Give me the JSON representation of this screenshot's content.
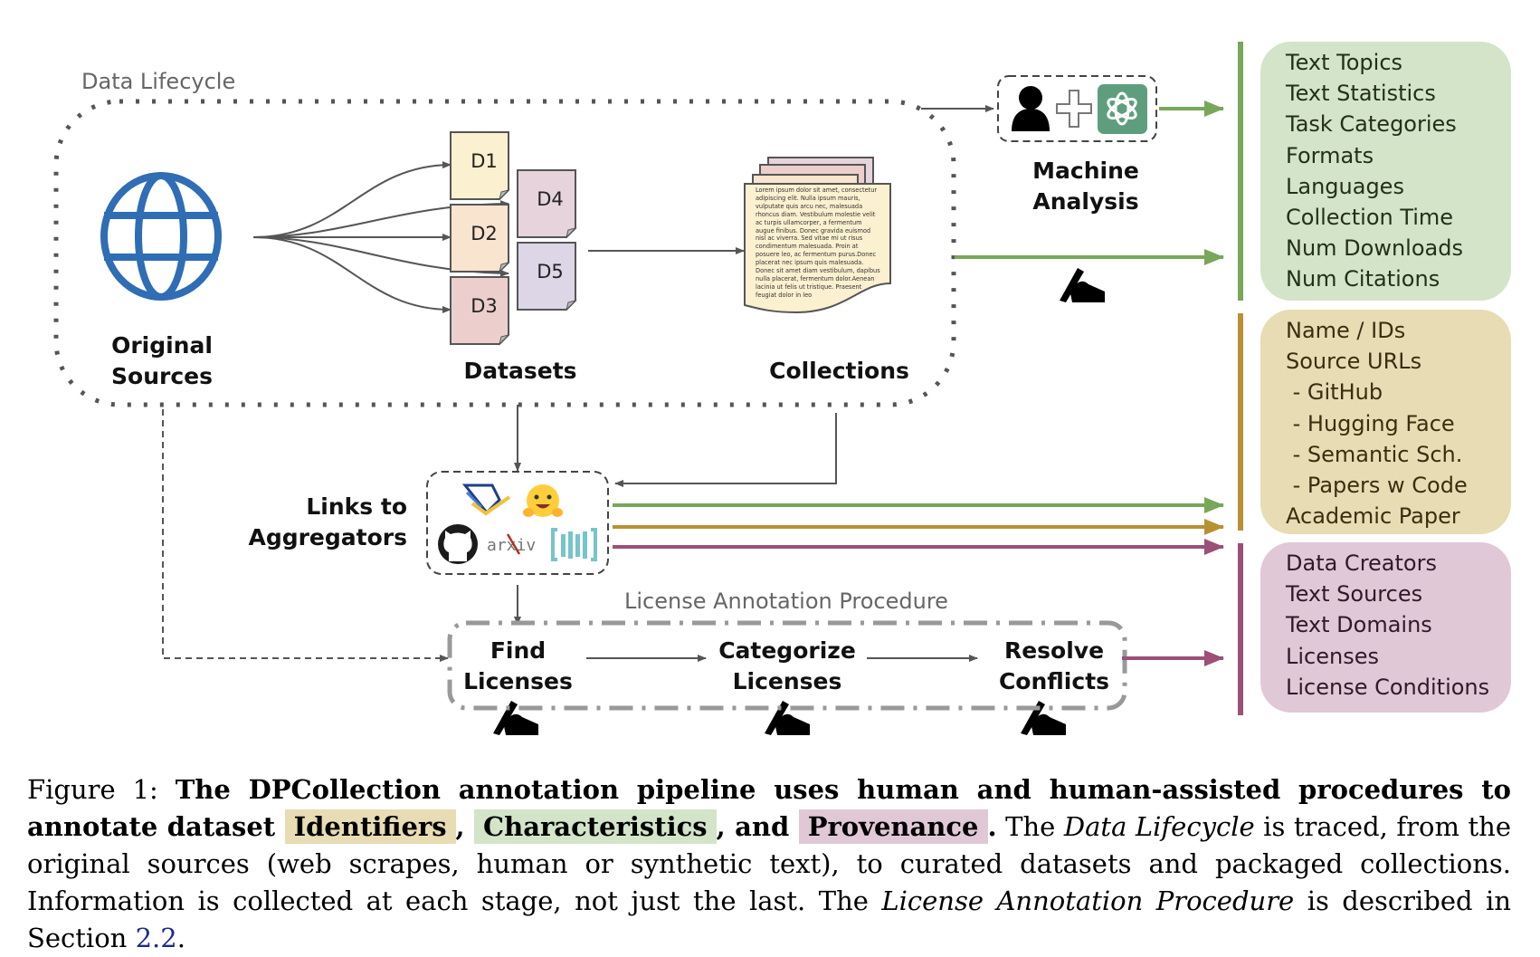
{
  "figure": {
    "data_lifecycle_label": "Data Lifecycle",
    "original_sources": {
      "line1": "Original",
      "line2": "Sources",
      "icon": "globe-icon"
    },
    "datasets": {
      "label": "Datasets",
      "items": [
        {
          "id": "D1",
          "color": "#fbf0cf"
        },
        {
          "id": "D2",
          "color": "#f8e4cf"
        },
        {
          "id": "D3",
          "color": "#eccfcc"
        },
        {
          "id": "D4",
          "color": "#e6d3dc"
        },
        {
          "id": "D5",
          "color": "#dcd6e6"
        }
      ]
    },
    "collections": {
      "label": "Collections",
      "lorem": "Lorem ipsum dolor sit amet, consectetur adipiscing elit. Nulla ipsum mauris, vulputate quis arcu nec, malesuada rhoncus diam. Vestibulum molestie velit ac turpis ullamcorper, a fermentum augue finibus. Donec gravida euismod nisl ac viverra. Sed vitae mi ut risus condimentum malesuada. Proin at posuere leo, ac fermentum purus.Donec placerat nec ipsum quis malesuada. Donec sit amet diam vestibulum, dapibus nulla placerat, fermentum dolor.Aenean lacinia ut felis ut tristique. Praesent feugiat dolor in leo",
      "page_colors": [
        "#e6d3dc",
        "#eccfcc",
        "#f8e4cf",
        "#fbf0cf"
      ]
    },
    "machine_analysis": {
      "line1": "Machine",
      "line2": "Analysis",
      "icons": [
        "person-icon",
        "plus-icon",
        "openai-logo-icon"
      ]
    },
    "aggregators": {
      "line1": "Links to",
      "line2": "Aggregators",
      "icons": [
        "semantic-scholar-icon",
        "hugging-face-icon",
        "github-icon",
        "arxiv-icon",
        "papers-with-code-icon"
      ],
      "arxiv_text": "arXiv"
    },
    "license_procedure": {
      "label": "License Annotation Procedure",
      "steps": [
        {
          "line1": "Find",
          "line2": "Licenses"
        },
        {
          "line1": "Categorize",
          "line2": "Licenses"
        },
        {
          "line1": "Resolve",
          "line2": "Conflicts"
        }
      ]
    },
    "panels": {
      "characteristics": {
        "color": "#78a75a",
        "items": [
          "Text Topics",
          "Text Statistics",
          "Task Categories",
          "Formats",
          "Languages",
          "Collection Time",
          "Num Downloads",
          "Num Citations"
        ]
      },
      "identifiers": {
        "color": "#b99134",
        "items": [
          "Name / IDs",
          "Source URLs",
          " - GitHub",
          " - Hugging Face",
          " - Semantic Sch.",
          " - Papers w Code",
          "Academic Paper"
        ]
      },
      "provenance": {
        "color": "#9b5077",
        "items": [
          "Data Creators",
          "Text Sources",
          "Text Domains",
          "Licenses",
          "License Conditions"
        ]
      }
    }
  },
  "caption": {
    "prefix": "Figure 1: ",
    "bold_lead": "The DPCollection annotation pipeline uses human and human-assisted procedures to annotate dataset ",
    "hl_identifiers": "Identifiers",
    "sep1": ", ",
    "hl_characteristics": "Characteristics",
    "sep2": ", and ",
    "hl_provenance": "Provenance",
    "bold_end": ".",
    "t1": "  The ",
    "i1": "Data Lifecycle",
    "t2": " is traced, from the original sources (web scrapes, human or synthetic text), to curated datasets and packaged collections. Information is collected at each stage, not just the last. The ",
    "i2": "License Annotation Procedure",
    "t3": " is described in Section ",
    "ref": "2.2",
    "t4": "."
  }
}
